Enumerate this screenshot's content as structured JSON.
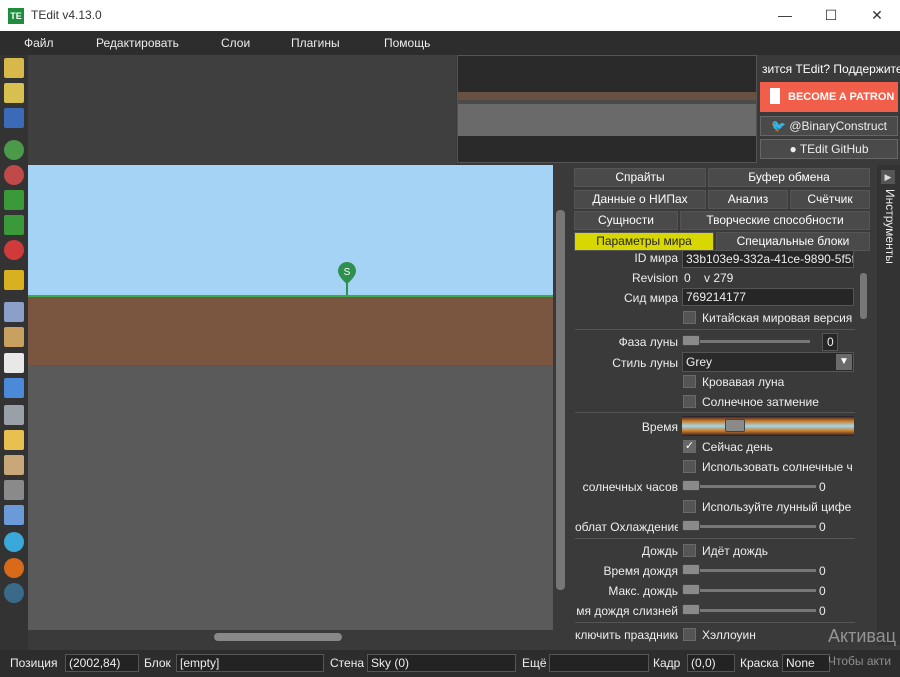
{
  "window": {
    "icon_text": "TE",
    "title": "TEdit v4.13.0",
    "minimize": "—",
    "maximize": "☐",
    "close": "✕"
  },
  "menu": [
    "Файл",
    "Редактировать",
    "Слои",
    "Плагины",
    "Помощь"
  ],
  "support": {
    "text": "зится TEdit? Поддержите",
    "patron_label": "BECOME A PATRON",
    "twitter_label": "@BinaryConstruct",
    "github_label": "TEdit GitHub"
  },
  "tabs": [
    "Спрайты",
    "Буфер обмена",
    "Данные о НИПах",
    "Анализ",
    "Счётчик",
    "Сущности",
    "Творческие способности",
    "Параметры мира",
    "Специальные блоки"
  ],
  "side_tab_label": "Инструменты",
  "world": {
    "id_label": "ID мира",
    "id_value": "33b103e9-332a-41ce-9890-5f5f",
    "revision_label": "Revision",
    "revision_value": "0",
    "version_value": "v 279",
    "seed_label": "Сид мира",
    "seed_value": "769214177",
    "chinese_label": "Китайская мировая версия",
    "moon_phase_label": "Фаза луны",
    "moon_phase_value": "0",
    "moon_style_label": "Стиль луны",
    "moon_style_value": "Grey",
    "blood_moon_label": "Кровавая луна",
    "eclipse_label": "Солнечное затмение",
    "time_label": "Время",
    "time_fraction": 0.28,
    "daytime_label": "Сейчас день",
    "daytime_checked": true,
    "sundial_label": "Использовать солнечные ч",
    "sundial_hours_label": "солнечных часов",
    "sundial_hours_value": "0",
    "moondial_label": "Используйте лунный цифе",
    "cooldown_label": "облат Охлаждение",
    "cooldown_value": "0",
    "rain_label": "Дождь",
    "raining_label": "Идёт дождь",
    "rain_time_label": "Время дождя",
    "rain_time_value": "0",
    "max_rain_label": "Макс. дождь",
    "max_rain_value": "0",
    "slime_rain_label": "мя дождя слизней",
    "slime_rain_value": "0",
    "holidays_label": "ключить праздники",
    "halloween_label": "Хэллоуин"
  },
  "status": {
    "position_label": "Позиция",
    "position_value": "(2002,84)",
    "block_label": "Блок",
    "block_value": "[empty]",
    "wall_label": "Стена",
    "wall_value": "Sky (0)",
    "more_label": "Ещё",
    "more_value": "",
    "frame_label": "Кадр",
    "frame_value": "(0,0)",
    "paint_label": "Краска",
    "paint_value": "None"
  },
  "watermark": {
    "line1": "Активац",
    "line2": "Чтобы акти"
  },
  "colors": {
    "sky": "#a5d3f5",
    "dirt": "#7a5540",
    "grass": "#3fa84f",
    "spawn_marker": "#2f8f4f",
    "patron": "#f15f4a",
    "active_tab": "#d8d800"
  }
}
